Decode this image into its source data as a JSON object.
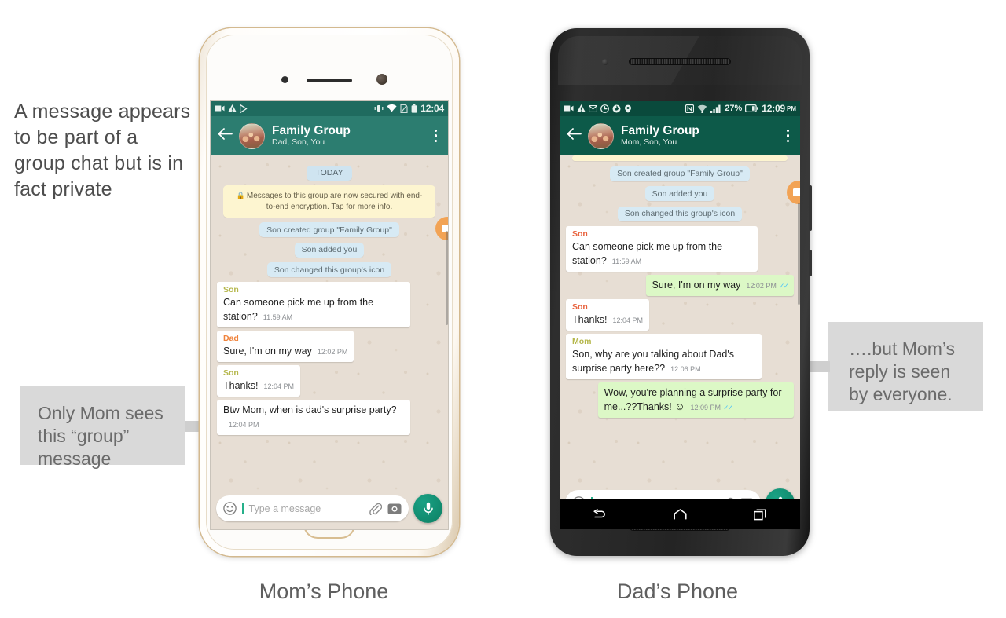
{
  "annotations": {
    "intro": "A message appears to be part of a group chat but is in fact private",
    "callout_left": "Only Mom sees this “group” message",
    "callout_right": "….but Mom’s reply is seen by everyone.",
    "caption_left": "Mom’s Phone",
    "caption_right": "Dad’s Phone",
    "callout_bg": "#d9d9d9",
    "arrow_color": "#cfcfcf"
  },
  "phone_left": {
    "device": "white-gold-phone",
    "statusbar": {
      "time": "12:04",
      "ampm": "",
      "battery_percent": "",
      "icons_left": [
        "video-camera-icon",
        "warning-triangle-icon",
        "play-store-icon"
      ],
      "icons_right": [
        "vibrate-icon",
        "wifi-icon",
        "sim-card-icon",
        "battery-icon"
      ]
    },
    "appbar": {
      "back": "back-arrow-icon",
      "title": "Family Group",
      "subtitle": "Dad, Son, You",
      "menu": "overflow-menu-icon",
      "bg": "#2c7d70"
    },
    "chat": {
      "day_divider": "TODAY",
      "encryption_notice": "Messages to this group are now secured with end-to-end encryption. Tap for more info.",
      "system_events": [
        "Son created group \"Family Group\"",
        "Son added you",
        "Son changed this group's icon"
      ],
      "messages": [
        {
          "sender": "Son",
          "sender_color": "olive",
          "text": "Can someone pick me up from the station?",
          "time": "11:59 AM",
          "direction": "in"
        },
        {
          "sender": "Dad",
          "sender_color": "orange",
          "text": "Sure, I'm on my way",
          "time": "12:02 PM",
          "direction": "in"
        },
        {
          "sender": "Son",
          "sender_color": "olive",
          "text": "Thanks!",
          "time": "12:04 PM",
          "direction": "in"
        },
        {
          "sender": "",
          "sender_color": "",
          "text": "Btw Mom, when is dad's surprise party?",
          "time": "12:04 PM",
          "direction": "in"
        }
      ]
    },
    "composer": {
      "emoji_icon": "smiley-icon",
      "placeholder": "Type a message",
      "attach_icon": "paperclip-icon",
      "camera_icon": "camera-icon",
      "mic_icon": "microphone-icon"
    }
  },
  "phone_right": {
    "device": "black-phone",
    "statusbar": {
      "time": "12:09",
      "ampm": "PM",
      "battery_percent": "27%",
      "icons_left": [
        "video-camera-icon",
        "warning-triangle-icon",
        "gmail-icon",
        "clock-icon",
        "firefox-icon",
        "location-icon"
      ],
      "icons_right": [
        "nfc-icon",
        "wifi-icon",
        "signal-bars-icon",
        "battery-icon"
      ]
    },
    "appbar": {
      "back": "back-arrow-icon",
      "title": "Family Group",
      "subtitle": "Mom, Son, You",
      "menu": "overflow-menu-icon",
      "bg": "#0d5a49"
    },
    "chat": {
      "system_events": [
        "Son created group \"Family Group\"",
        "Son added you",
        "Son changed this group's icon"
      ],
      "messages": [
        {
          "sender": "Son",
          "sender_color": "orange",
          "text": "Can someone pick me up from the station?",
          "time": "11:59 AM",
          "direction": "in",
          "ticks": false
        },
        {
          "sender": "",
          "sender_color": "",
          "text": "Sure, I'm on my way",
          "time": "12:02 PM",
          "direction": "out",
          "ticks": true
        },
        {
          "sender": "Son",
          "sender_color": "orange",
          "text": "Thanks!",
          "time": "12:04 PM",
          "direction": "in",
          "ticks": false
        },
        {
          "sender": "Mom",
          "sender_color": "olive",
          "text": "Son, why are you talking about Dad's surprise party here??",
          "time": "12:06 PM",
          "direction": "in",
          "ticks": false
        },
        {
          "sender": "",
          "sender_color": "",
          "text": "Wow, you're planning a surprise party for me...??Thanks! ",
          "emoji": "☺",
          "time": "12:09 PM",
          "direction": "out",
          "ticks": true
        }
      ]
    },
    "composer": {
      "emoji_icon": "smiley-icon",
      "placeholder": "Type a message",
      "attach_icon": "paperclip-icon",
      "camera_icon": "camera-icon",
      "mic_icon": "microphone-icon"
    },
    "navbar": [
      "back-nav-icon",
      "home-nav-icon",
      "recents-nav-icon"
    ]
  }
}
